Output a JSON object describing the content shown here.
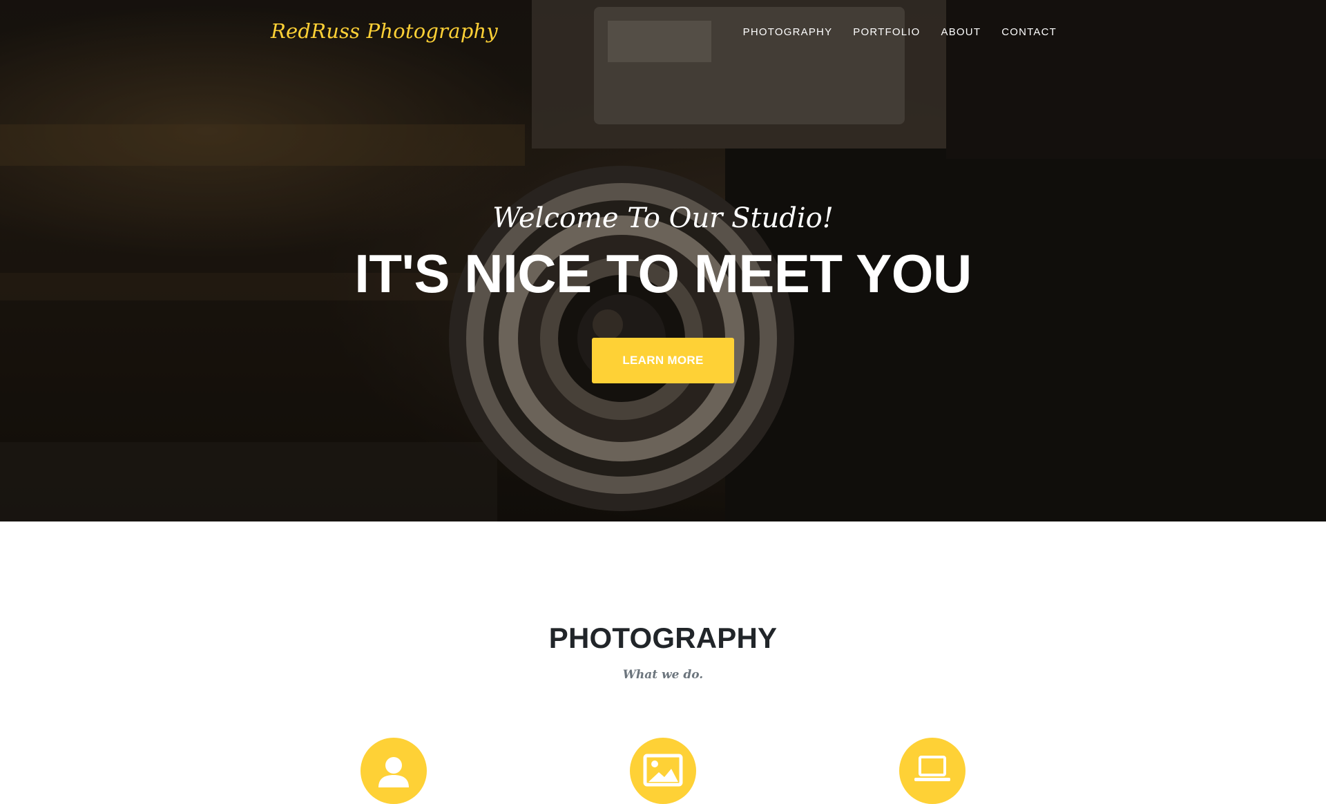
{
  "navbar": {
    "brand": "RedRuss Photography",
    "links": [
      "PHOTOGRAPHY",
      "PORTFOLIO",
      "ABOUT",
      "CONTACT"
    ]
  },
  "hero": {
    "lead": "Welcome To Our Studio!",
    "heading": "IT'S NICE TO MEET YOU",
    "button_label": "LEARN MORE",
    "background": "camera-photo"
  },
  "services": {
    "heading": "PHOTOGRAPHY",
    "subheading": "What we do.",
    "icons": [
      "user-icon",
      "image-icon",
      "laptop-icon"
    ]
  },
  "colors": {
    "accent": "#fed136",
    "heading_text": "#212529",
    "muted_text": "#6c757d"
  }
}
